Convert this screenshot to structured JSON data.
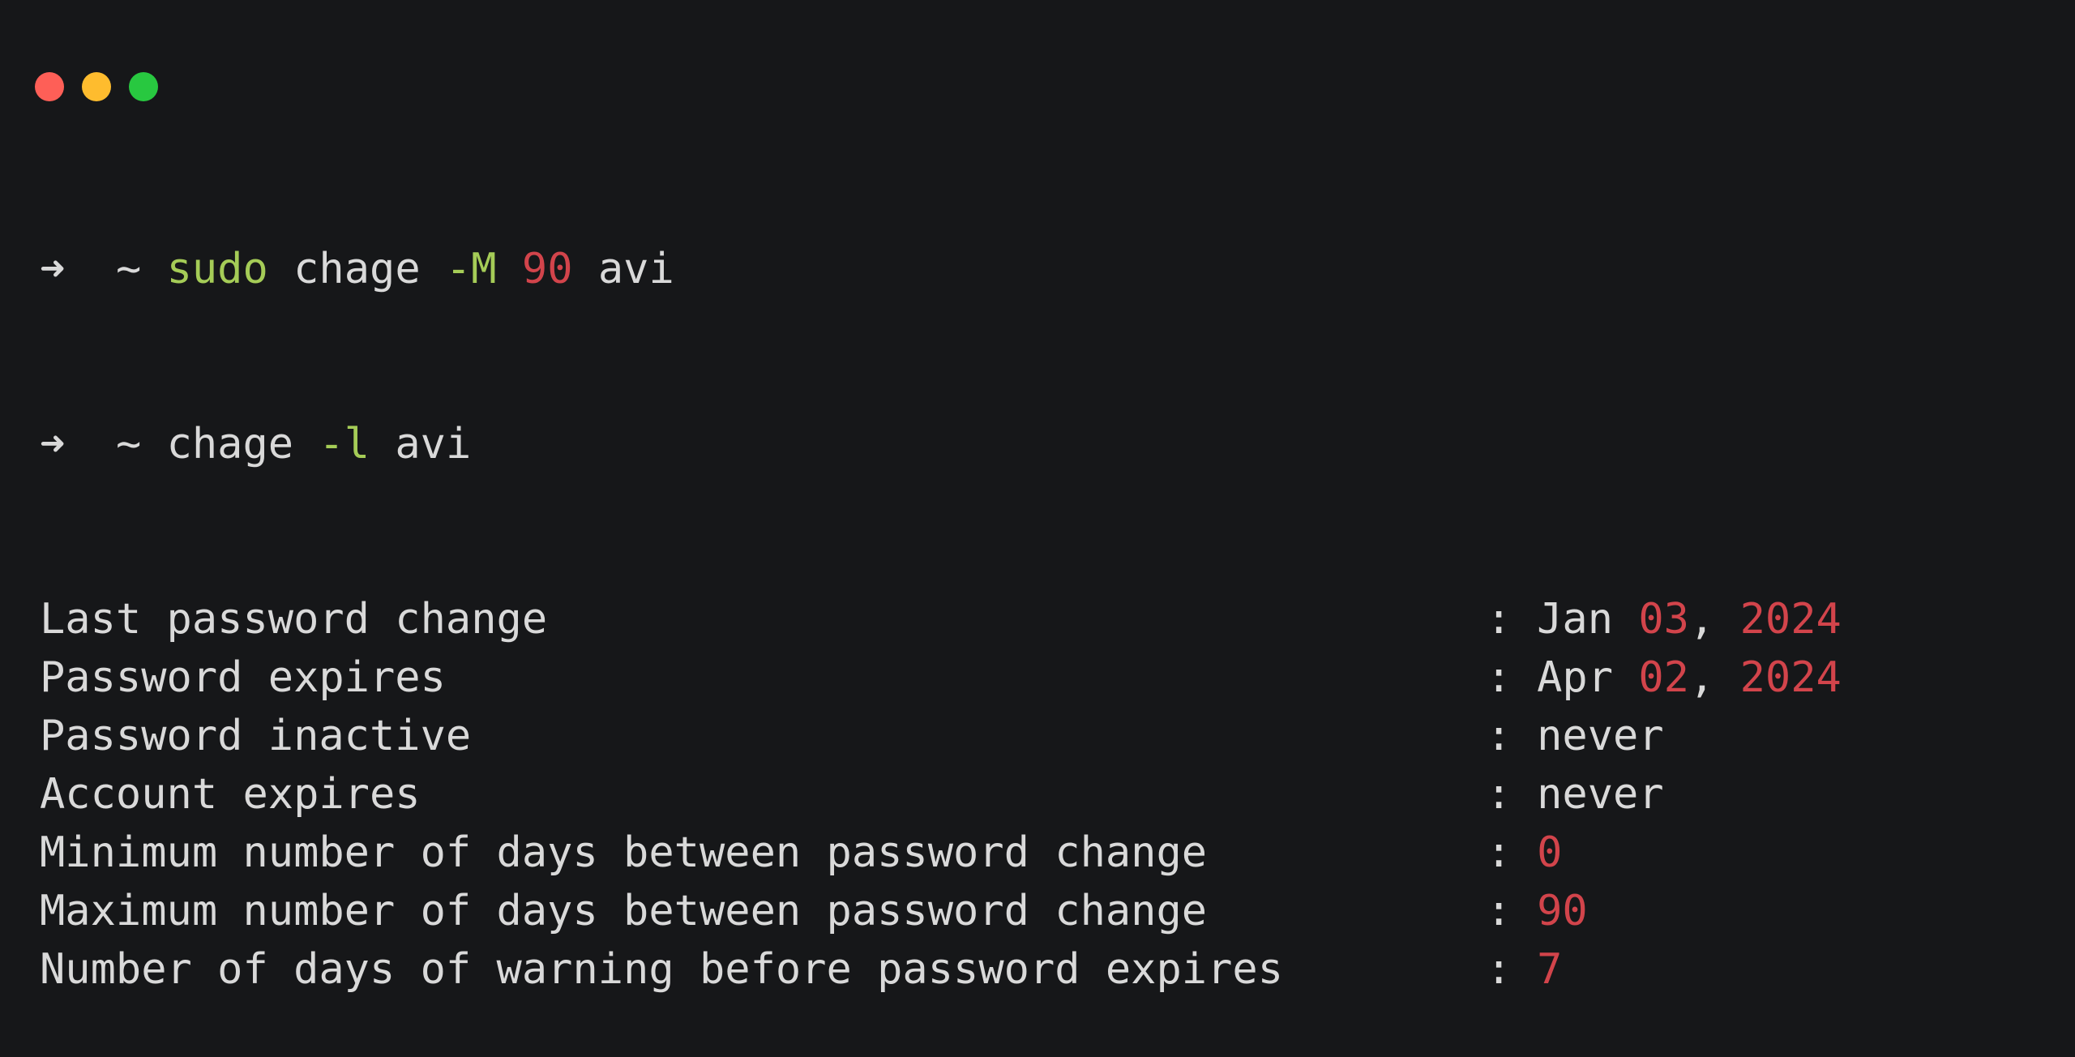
{
  "window": {
    "controls": [
      {
        "name": "close",
        "color": "#fe5f57"
      },
      {
        "name": "minimize",
        "color": "#febc2e"
      },
      {
        "name": "maximize",
        "color": "#28c840"
      }
    ]
  },
  "colors": {
    "background": "#161719",
    "text": "#d9d9d9",
    "green": "#a5cc57",
    "red": "#d2444b"
  },
  "commands": [
    {
      "prompt_icon": "arrow-right-icon",
      "prompt_symbol": "➜",
      "cwd": "~",
      "sudo": "sudo",
      "cmd": "chage",
      "flag": "-M",
      "arg_num": "90",
      "arg": "avi"
    },
    {
      "prompt_icon": "arrow-right-icon",
      "prompt_symbol": "➜",
      "cwd": "~",
      "cmd": "chage",
      "flag": "-l",
      "arg": "avi"
    }
  ],
  "output": [
    {
      "label": "Last password change",
      "sep": ":",
      "parts": [
        {
          "t": "Jan ",
          "c": "text"
        },
        {
          "t": "03",
          "c": "red"
        },
        {
          "t": ", ",
          "c": "text"
        },
        {
          "t": "2024",
          "c": "red"
        }
      ]
    },
    {
      "label": "Password expires",
      "sep": ":",
      "parts": [
        {
          "t": "Apr ",
          "c": "text"
        },
        {
          "t": "02",
          "c": "red"
        },
        {
          "t": ", ",
          "c": "text"
        },
        {
          "t": "2024",
          "c": "red"
        }
      ]
    },
    {
      "label": "Password inactive",
      "sep": ":",
      "parts": [
        {
          "t": "never",
          "c": "text"
        }
      ]
    },
    {
      "label": "Account expires",
      "sep": ":",
      "parts": [
        {
          "t": "never",
          "c": "text"
        }
      ]
    },
    {
      "label": "Minimum number of days between password change",
      "sep": ":",
      "parts": [
        {
          "t": "0",
          "c": "red"
        }
      ]
    },
    {
      "label": "Maximum number of days between password change",
      "sep": ":",
      "parts": [
        {
          "t": "90",
          "c": "red"
        }
      ]
    },
    {
      "label": "Number of days of warning before password expires",
      "sep": ":",
      "parts": [
        {
          "t": "7",
          "c": "red"
        }
      ]
    }
  ]
}
